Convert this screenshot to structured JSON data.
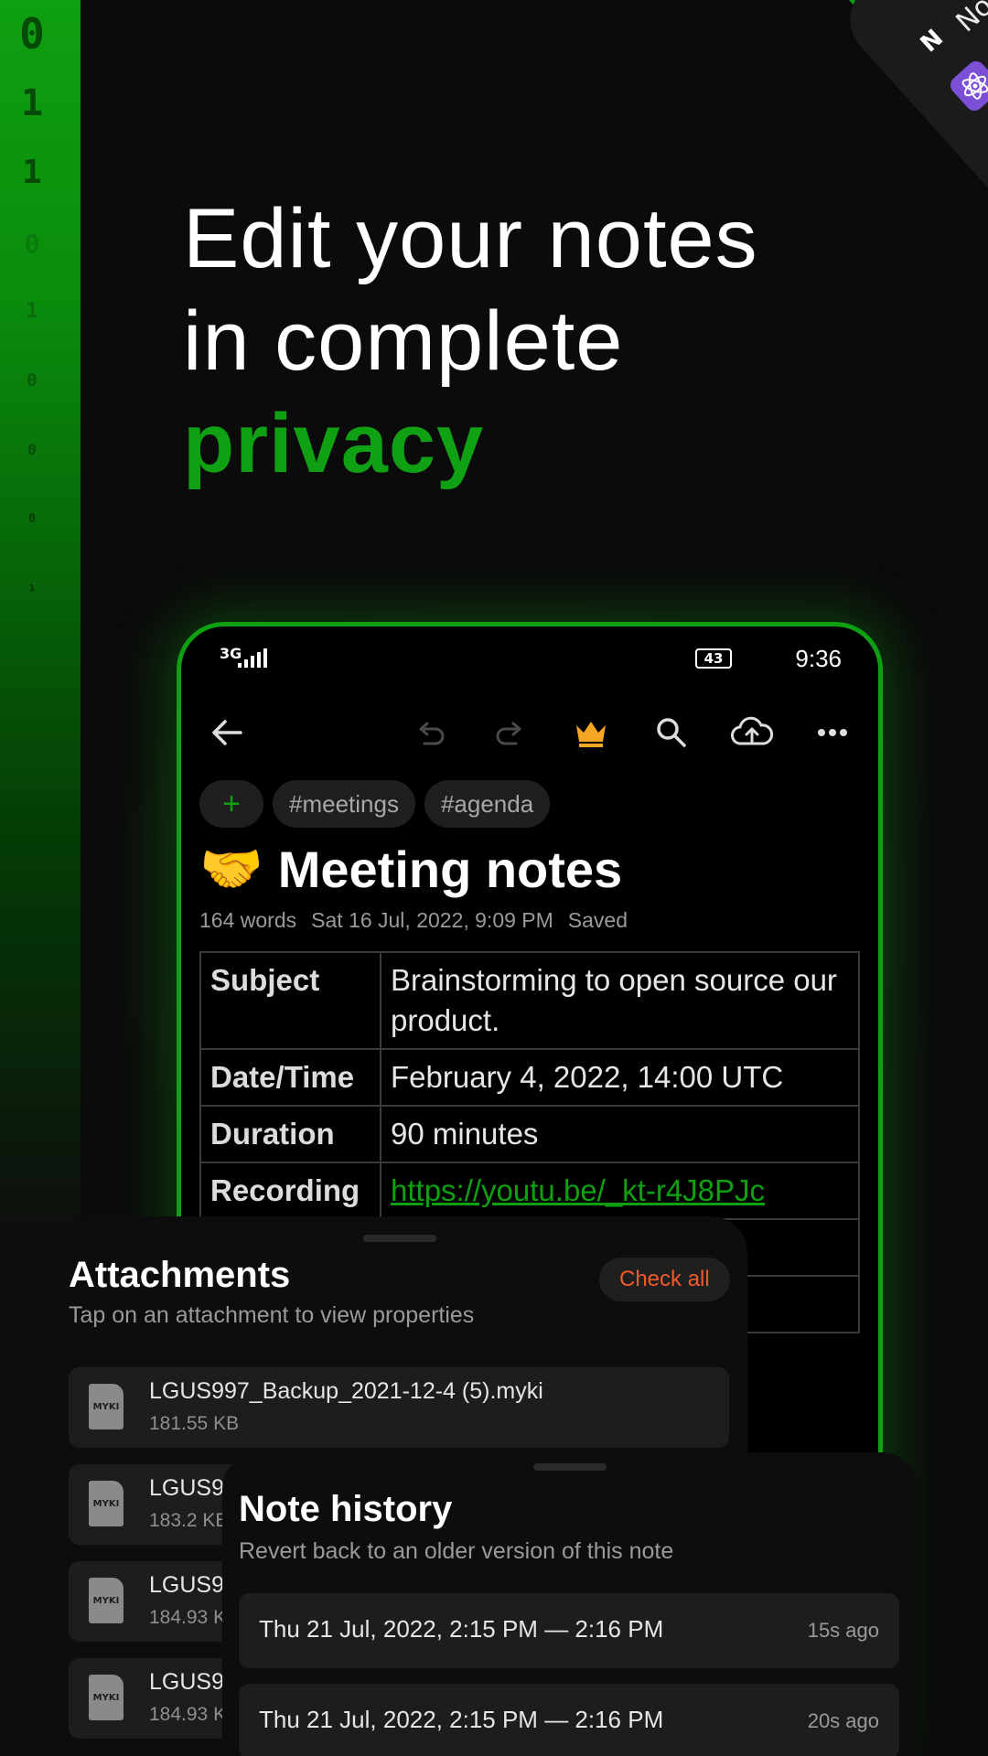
{
  "headline": {
    "line1": "Edit your notes",
    "line2": "in complete",
    "accent": "privacy"
  },
  "binary_digits": [
    "0",
    "1",
    "1",
    "0",
    "1",
    "0",
    "0",
    "0",
    "1"
  ],
  "corner_card": {
    "letter": "N",
    "title_fragment": "No"
  },
  "colors": {
    "accent": "#0ea011",
    "check_all": "#f25a2c",
    "crown": "#f5a623"
  },
  "status_bar": {
    "network": "3G",
    "battery": "43",
    "time": "9:36"
  },
  "toolbar": {
    "icons": [
      "back-arrow-icon",
      "undo-icon",
      "redo-icon",
      "crown-icon",
      "search-icon",
      "cloud-upload-icon",
      "more-icon"
    ]
  },
  "tags": {
    "add": "+",
    "items": [
      "#meetings",
      "#agenda"
    ]
  },
  "note": {
    "emoji": "🤝",
    "title": "Meeting notes",
    "words": "164 words",
    "date": "Sat 16 Jul, 2022, 9:09 PM",
    "status": "Saved"
  },
  "properties": [
    {
      "key": "Subject",
      "value": "Brainstorming to open source our product."
    },
    {
      "key": "Date/Time",
      "value": "February 4, 2022, 14:00 UTC"
    },
    {
      "key": "Duration",
      "value": "90 minutes"
    },
    {
      "key": "Recording",
      "value": "https://youtu.be/_kt-r4J8PJc"
    }
  ],
  "attachments_sheet": {
    "title": "Attachments",
    "subtitle": "Tap on an attachment to view properties",
    "check_all": "Check all",
    "file_badge": "MYKI",
    "items": [
      {
        "name": "LGUS997_Backup_2021-12-4 (5).myki",
        "size": "181.55 KB"
      },
      {
        "name": "LGUS99",
        "size": "183.2 KB"
      },
      {
        "name": "LGUS99",
        "size": "184.93 K"
      },
      {
        "name": "LGUS99",
        "size": "184.93 K"
      }
    ]
  },
  "history_sheet": {
    "title": "Note history",
    "subtitle": "Revert back to an older version of this note",
    "items": [
      {
        "range": "Thu 21 Jul, 2022, 2:15 PM — 2:16 PM",
        "ago": "15s ago"
      },
      {
        "range": "Thu 21 Jul, 2022, 2:15 PM — 2:16 PM",
        "ago": "20s ago"
      }
    ]
  }
}
